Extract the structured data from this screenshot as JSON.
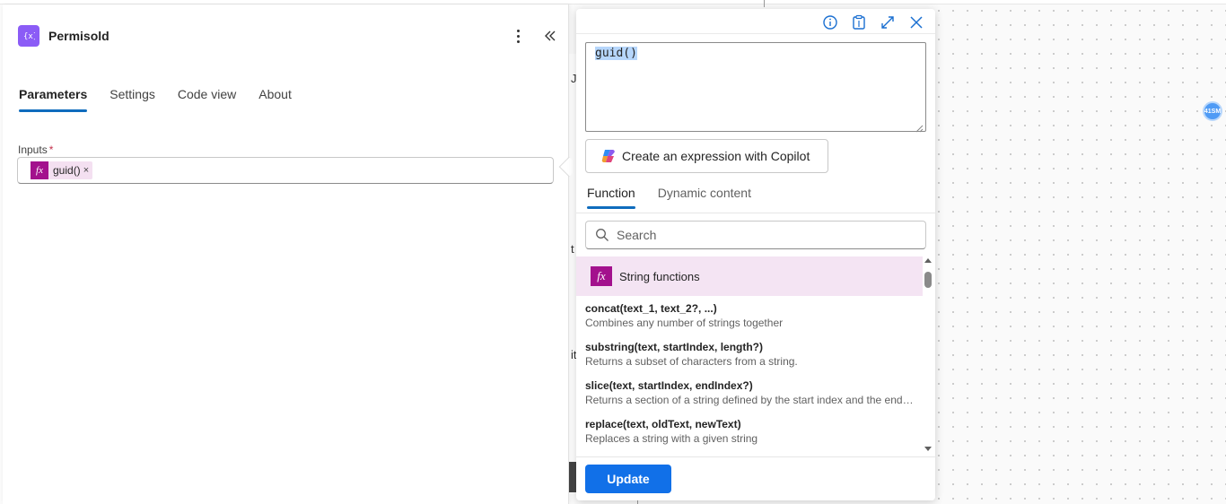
{
  "panel": {
    "title": "Permisold",
    "icon": "variable-icon",
    "tabs": [
      {
        "label": "Parameters",
        "active": true
      },
      {
        "label": "Settings",
        "active": false
      },
      {
        "label": "Code view",
        "active": false
      },
      {
        "label": "About",
        "active": false
      }
    ],
    "inputs_label": "Inputs",
    "required_mark": "*",
    "token": {
      "label": "guid()",
      "close": "×",
      "icon_text": "fx"
    }
  },
  "canvas": {
    "behind_letters": [
      "J",
      "t",
      "it"
    ],
    "avatar": "41SM"
  },
  "expression_editor": {
    "expression": "guid()",
    "copilot_button": "Create an expression with Copilot",
    "tabs": [
      {
        "label": "Function",
        "active": true
      },
      {
        "label": "Dynamic content",
        "active": false
      }
    ],
    "search_placeholder": "Search",
    "category": {
      "label": "String functions",
      "icon_text": "fx"
    },
    "functions": [
      {
        "signature": "concat(text_1, text_2?, ...)",
        "description": "Combines any number of strings together"
      },
      {
        "signature": "substring(text, startIndex, length?)",
        "description": "Returns a subset of characters from a string."
      },
      {
        "signature": "slice(text, startIndex, endIndex?)",
        "description": "Returns a section of a string defined by the start index and the end index."
      },
      {
        "signature": "replace(text, oldText, newText)",
        "description": "Replaces a string with a given string"
      }
    ],
    "update_button": "Update"
  },
  "colors": {
    "accent": "#0f6cbd",
    "primary_button": "#1170e8",
    "function_token": "#a3118d",
    "action_icon": "#8b5cf6"
  }
}
